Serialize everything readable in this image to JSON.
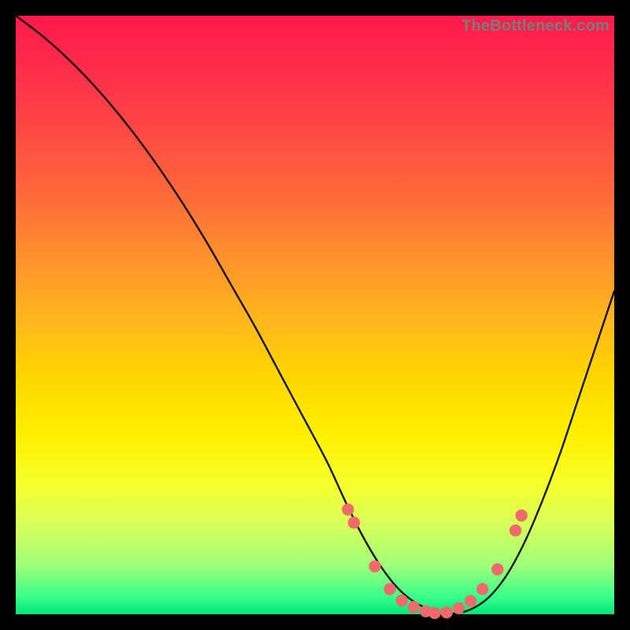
{
  "watermark": "TheBottleneck.com",
  "chart_data": {
    "type": "line",
    "title": "",
    "xlabel": "",
    "ylabel": "",
    "xlim": [
      0,
      100
    ],
    "ylim": [
      0,
      100
    ],
    "grid": false,
    "series": [
      {
        "name": "bottleneck-curve",
        "x": [
          0,
          4,
          8,
          12,
          16,
          20,
          24,
          28,
          32,
          36,
          40,
          44,
          48,
          52,
          55,
          58,
          61,
          64,
          67,
          70,
          73,
          76,
          79,
          82,
          85,
          88,
          91,
          94,
          97,
          100
        ],
        "y": [
          100,
          97,
          93.5,
          89.5,
          85,
          80,
          74.5,
          68.5,
          62,
          55,
          48,
          40.5,
          33,
          25.5,
          19,
          13,
          8,
          4.2,
          1.8,
          0.6,
          0.1,
          0.8,
          2.8,
          6.5,
          12,
          19,
          27,
          36,
          45,
          54
        ]
      }
    ],
    "markers": {
      "name": "highlight-dots",
      "points": [
        {
          "x": 55.5,
          "y": 17.5
        },
        {
          "x": 56.5,
          "y": 15.3
        },
        {
          "x": 60.0,
          "y": 8.0
        },
        {
          "x": 62.5,
          "y": 4.2
        },
        {
          "x": 64.5,
          "y": 2.3
        },
        {
          "x": 66.5,
          "y": 1.2
        },
        {
          "x": 68.5,
          "y": 0.5
        },
        {
          "x": 70.0,
          "y": 0.2
        },
        {
          "x": 72.0,
          "y": 0.3
        },
        {
          "x": 74.0,
          "y": 1.0
        },
        {
          "x": 76.0,
          "y": 2.2
        },
        {
          "x": 78.0,
          "y": 4.2
        },
        {
          "x": 80.5,
          "y": 7.5
        },
        {
          "x": 83.5,
          "y": 14.0
        },
        {
          "x": 84.5,
          "y": 16.5
        }
      ]
    },
    "background_gradient": {
      "top": "#ff1a4d",
      "mid": "#ffd500",
      "bottom": "#00e676"
    }
  }
}
